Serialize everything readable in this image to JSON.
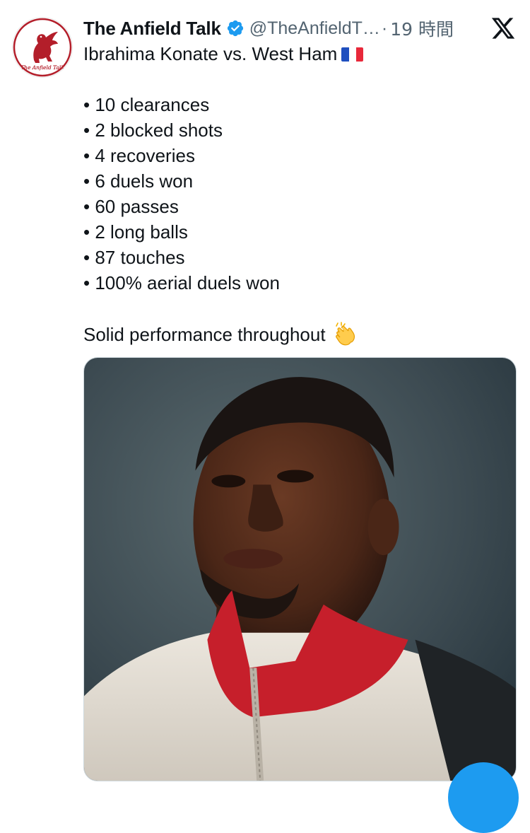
{
  "account": {
    "display_name": "The Anfield Talk",
    "handle": "@TheAnfieldT…",
    "separator": "·",
    "time": "19 時間",
    "avatar_text": "The Anfield Talk"
  },
  "icons": {
    "verified": "verified-badge-icon",
    "x_logo": "x-logo-icon",
    "flag": "france-flag-emoji",
    "clap": "clapping-hands-emoji"
  },
  "colors": {
    "brand_red": "#b31e2a",
    "verified_blue": "#1d9bf0",
    "text": "#0f1419",
    "secondary_text": "#536471"
  },
  "tweet": {
    "headline": "Ibrahima Konate vs. West Ham",
    "stats": [
      "• 10 clearances",
      "• 2 blocked shots",
      "• 4 recoveries",
      "• 6 duels won",
      "• 60 passes",
      "• 2 long balls",
      "• 87 touches",
      "• 100% aerial duels won"
    ],
    "closing": "Solid performance throughout"
  }
}
